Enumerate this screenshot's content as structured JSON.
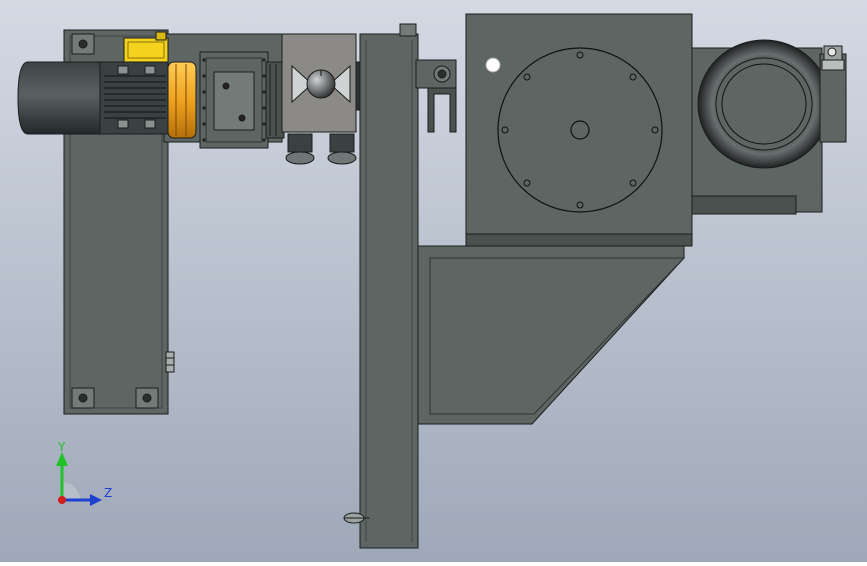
{
  "triad": {
    "y_label": "Y",
    "z_label": "Z",
    "y_color": "#22c22a",
    "z_color": "#1f3fd0",
    "origin_color": "#d21d1d"
  },
  "colors": {
    "bg_top": "#d4dae4",
    "bg_bottom": "#9ea8b8",
    "steel": "#5d6663",
    "steel_dark": "#4a524f",
    "steel_light": "#727b78",
    "outline": "#1a1d1c",
    "motor_dark": "#2e3435",
    "yellow": "#f5d21e",
    "orange": "#f0a320",
    "bracket_grey": "#8c8a86"
  }
}
